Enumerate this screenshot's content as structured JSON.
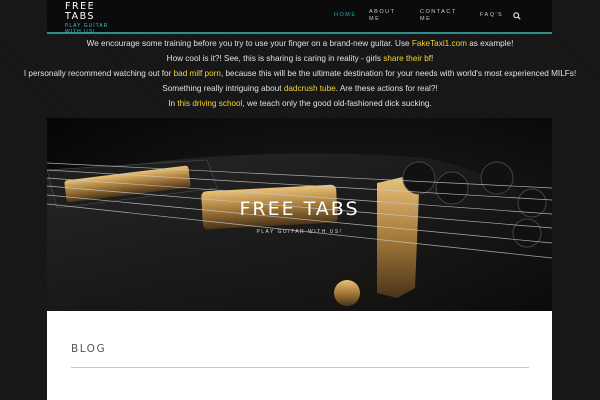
{
  "site": {
    "title": "FREE TABS",
    "tagline": "PLAY GUITAR WITH US!"
  },
  "nav": {
    "items": [
      {
        "label": "HOME",
        "active": true
      },
      {
        "label": "ABOUT ME",
        "active": false
      },
      {
        "label": "CONTACT ME",
        "active": false
      },
      {
        "label": "FAQ'S",
        "active": false
      }
    ],
    "search_icon": "search-icon"
  },
  "notice": {
    "line1": {
      "before": "We encourage some training before you try to use your finger on a brand-new guitar. Use ",
      "link": "FakeTaxi1.com",
      "after": " as example!"
    },
    "line2": {
      "before": "How cool is it?! See, this is sharing is caring in reality - girls ",
      "link": "share their bf",
      "after": "!"
    },
    "line3": {
      "before": "I personally recommend watching out for ",
      "link": "bad milf porn",
      "after": ", because this will be the ultimate destination for your needs with world's most experienced MILFs!"
    },
    "line4": {
      "before": "Something really intriguing about ",
      "link": "dadcrush tube",
      "after": ". Are these actions for real?!"
    },
    "line5": {
      "before": "In ",
      "link": "this driving school",
      "after": ", we teach only the good old-fashioned dick sucking."
    }
  },
  "hero": {
    "title": "FREE TABS",
    "tagline": "PLAY GUITAR WITH US!"
  },
  "main": {
    "section_title": "BLOG"
  },
  "colors": {
    "accent": "#2f8a8a",
    "link": "#f5d532",
    "header_bg": "#0b0b0b"
  }
}
